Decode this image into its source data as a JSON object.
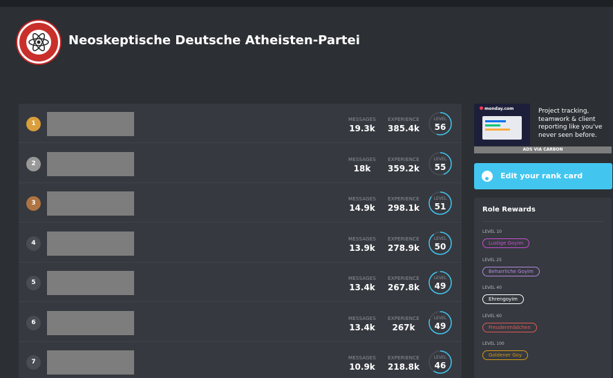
{
  "guild": {
    "name": "Neoskeptische Deutsche Atheisten-Partei",
    "logo_text": "NEO-SKEPTISCHE DEUTSCHE ATHEISTEN-PARTEI"
  },
  "labels": {
    "messages": "MESSAGES",
    "experience": "EXPERIENCE",
    "level": "LEVEL"
  },
  "leaderboard": [
    {
      "rank": "1",
      "messages": "19.3k",
      "experience": "385.4k",
      "level": "56",
      "progress": 0.55
    },
    {
      "rank": "2",
      "messages": "18k",
      "experience": "359.2k",
      "level": "55",
      "progress": 0.45
    },
    {
      "rank": "3",
      "messages": "14.9k",
      "experience": "298.1k",
      "level": "51",
      "progress": 0.85
    },
    {
      "rank": "4",
      "messages": "13.9k",
      "experience": "278.9k",
      "level": "50",
      "progress": 0.9
    },
    {
      "rank": "5",
      "messages": "13.4k",
      "experience": "267.8k",
      "level": "49",
      "progress": 0.95
    },
    {
      "rank": "6",
      "messages": "13.4k",
      "experience": "267k",
      "level": "49",
      "progress": 0.8
    },
    {
      "rank": "7",
      "messages": "10.9k",
      "experience": "218.8k",
      "level": "46",
      "progress": 0.6
    }
  ],
  "ad": {
    "brand": "monday.com",
    "text": "Project tracking, teamwork & client reporting like you've never seen before.",
    "footer": "ADS VIA CARBON"
  },
  "edit_card": {
    "label": "Edit your rank card"
  },
  "role_rewards": {
    "title": "Role Rewards",
    "items": [
      {
        "level": "LEVEL 10",
        "role": "Lustige Goyim",
        "color": "#c94fd4"
      },
      {
        "level": "LEVEL 25",
        "role": "Beharrliche Goyim",
        "color": "#b489e0"
      },
      {
        "level": "LEVEL 40",
        "role": "Ehrengoyim",
        "color": "#ffffff"
      },
      {
        "level": "LEVEL 60",
        "role": "Freudenmädchen",
        "color": "#e05a5a"
      },
      {
        "level": "LEVEL 100",
        "role": "Goldener Goy",
        "color": "#d69a17"
      }
    ]
  },
  "colors": {
    "accent": "#42c6f0",
    "rank_gold": "#da9e3b",
    "rank_silver": "#989898",
    "rank_bronze": "#ae7441",
    "ring": "#42c6f0"
  }
}
